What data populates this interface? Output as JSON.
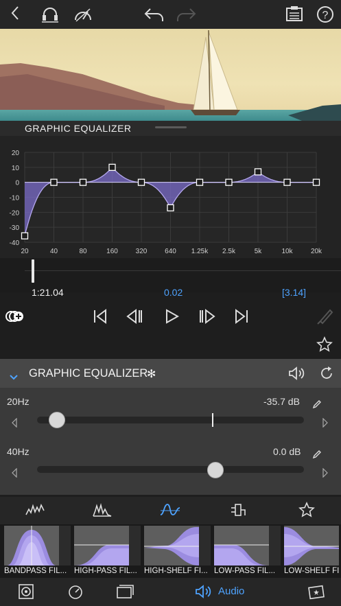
{
  "colors": {
    "accent": "#4ea3ff",
    "eq_fill": "#7b6cc9",
    "eq_line": "#b5a8ef"
  },
  "topbar": {
    "icons": [
      "chevron-left-icon",
      "headphones-icon",
      "speedometer-icon",
      "undo-icon",
      "redo-icon",
      "clipboard-icon",
      "help-icon"
    ],
    "help_label": "?"
  },
  "eq_title": "GRAPHIC EQUALIZER",
  "chart_data": {
    "type": "line",
    "x": [
      "20",
      "40",
      "80",
      "160",
      "320",
      "640",
      "1.25k",
      "2.5k",
      "5k",
      "10k",
      "20k"
    ],
    "values": [
      -35.7,
      0,
      0,
      10,
      0,
      -17,
      0,
      0,
      7,
      0,
      0
    ],
    "ylim": [
      -40,
      20
    ],
    "yticks": [
      "20",
      "10",
      "0",
      "-10",
      "-20",
      "-30",
      "-40"
    ],
    "grid": true
  },
  "timeline": {
    "current": "1:21.04",
    "duration": "0.02",
    "total": "[3.14]"
  },
  "panel": {
    "title": "GRAPHIC EQUALIZER",
    "title_glyph": "✻",
    "bands": [
      {
        "label": "20Hz",
        "value": "-35.7 dB",
        "level_db": -35.7
      },
      {
        "label": "40Hz",
        "value": "0.0 dB",
        "level_db": 0.0
      }
    ]
  },
  "tabs": [
    "waveform-icon",
    "spectrum-icon",
    "filter-icon",
    "plugin-icon",
    "star-icon"
  ],
  "presets": [
    {
      "label": "BANDPASS FIL..."
    },
    {
      "label": "HIGH-PASS FIL..."
    },
    {
      "label": "HIGH-SHELF FI..."
    },
    {
      "label": "LOW-PASS FIL..."
    },
    {
      "label": "LOW-SHELF FI"
    }
  ],
  "bottombar": {
    "audio_label": "Audio"
  }
}
